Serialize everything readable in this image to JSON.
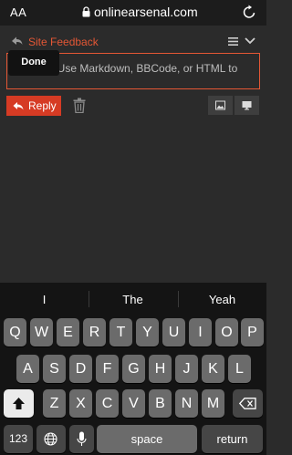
{
  "browser": {
    "text_size_label": "AA",
    "domain": "onlinearsenal.com"
  },
  "composer": {
    "topic_title": "Site Feedback",
    "editor_placeholder_line1": ". Use Markdown, BBCode, or HTML to",
    "editor_placeholder_line2": "",
    "done_label": "Done",
    "reply_label": "Reply"
  },
  "keyboard": {
    "suggestions": [
      "I",
      "The",
      "Yeah"
    ],
    "row1": [
      "Q",
      "W",
      "E",
      "R",
      "T",
      "Y",
      "U",
      "I",
      "O",
      "P"
    ],
    "row2": [
      "A",
      "S",
      "D",
      "F",
      "G",
      "H",
      "J",
      "K",
      "L"
    ],
    "row3": [
      "Z",
      "X",
      "C",
      "V",
      "B",
      "N",
      "M"
    ],
    "numbers_label": "123",
    "space_label": "space",
    "return_label": "return"
  },
  "colors": {
    "accent": "#e45735",
    "reply_button": "#d63b24",
    "background": "#2b2b2b",
    "keyboard_bg": "#141414"
  },
  "icons": [
    "lock-icon",
    "reload-icon",
    "reply-arrow-icon",
    "hamburger-icon",
    "chevron-down-icon",
    "trash-icon",
    "image-icon",
    "preview-icon",
    "shift-icon",
    "backspace-icon",
    "globe-icon",
    "microphone-icon"
  ]
}
